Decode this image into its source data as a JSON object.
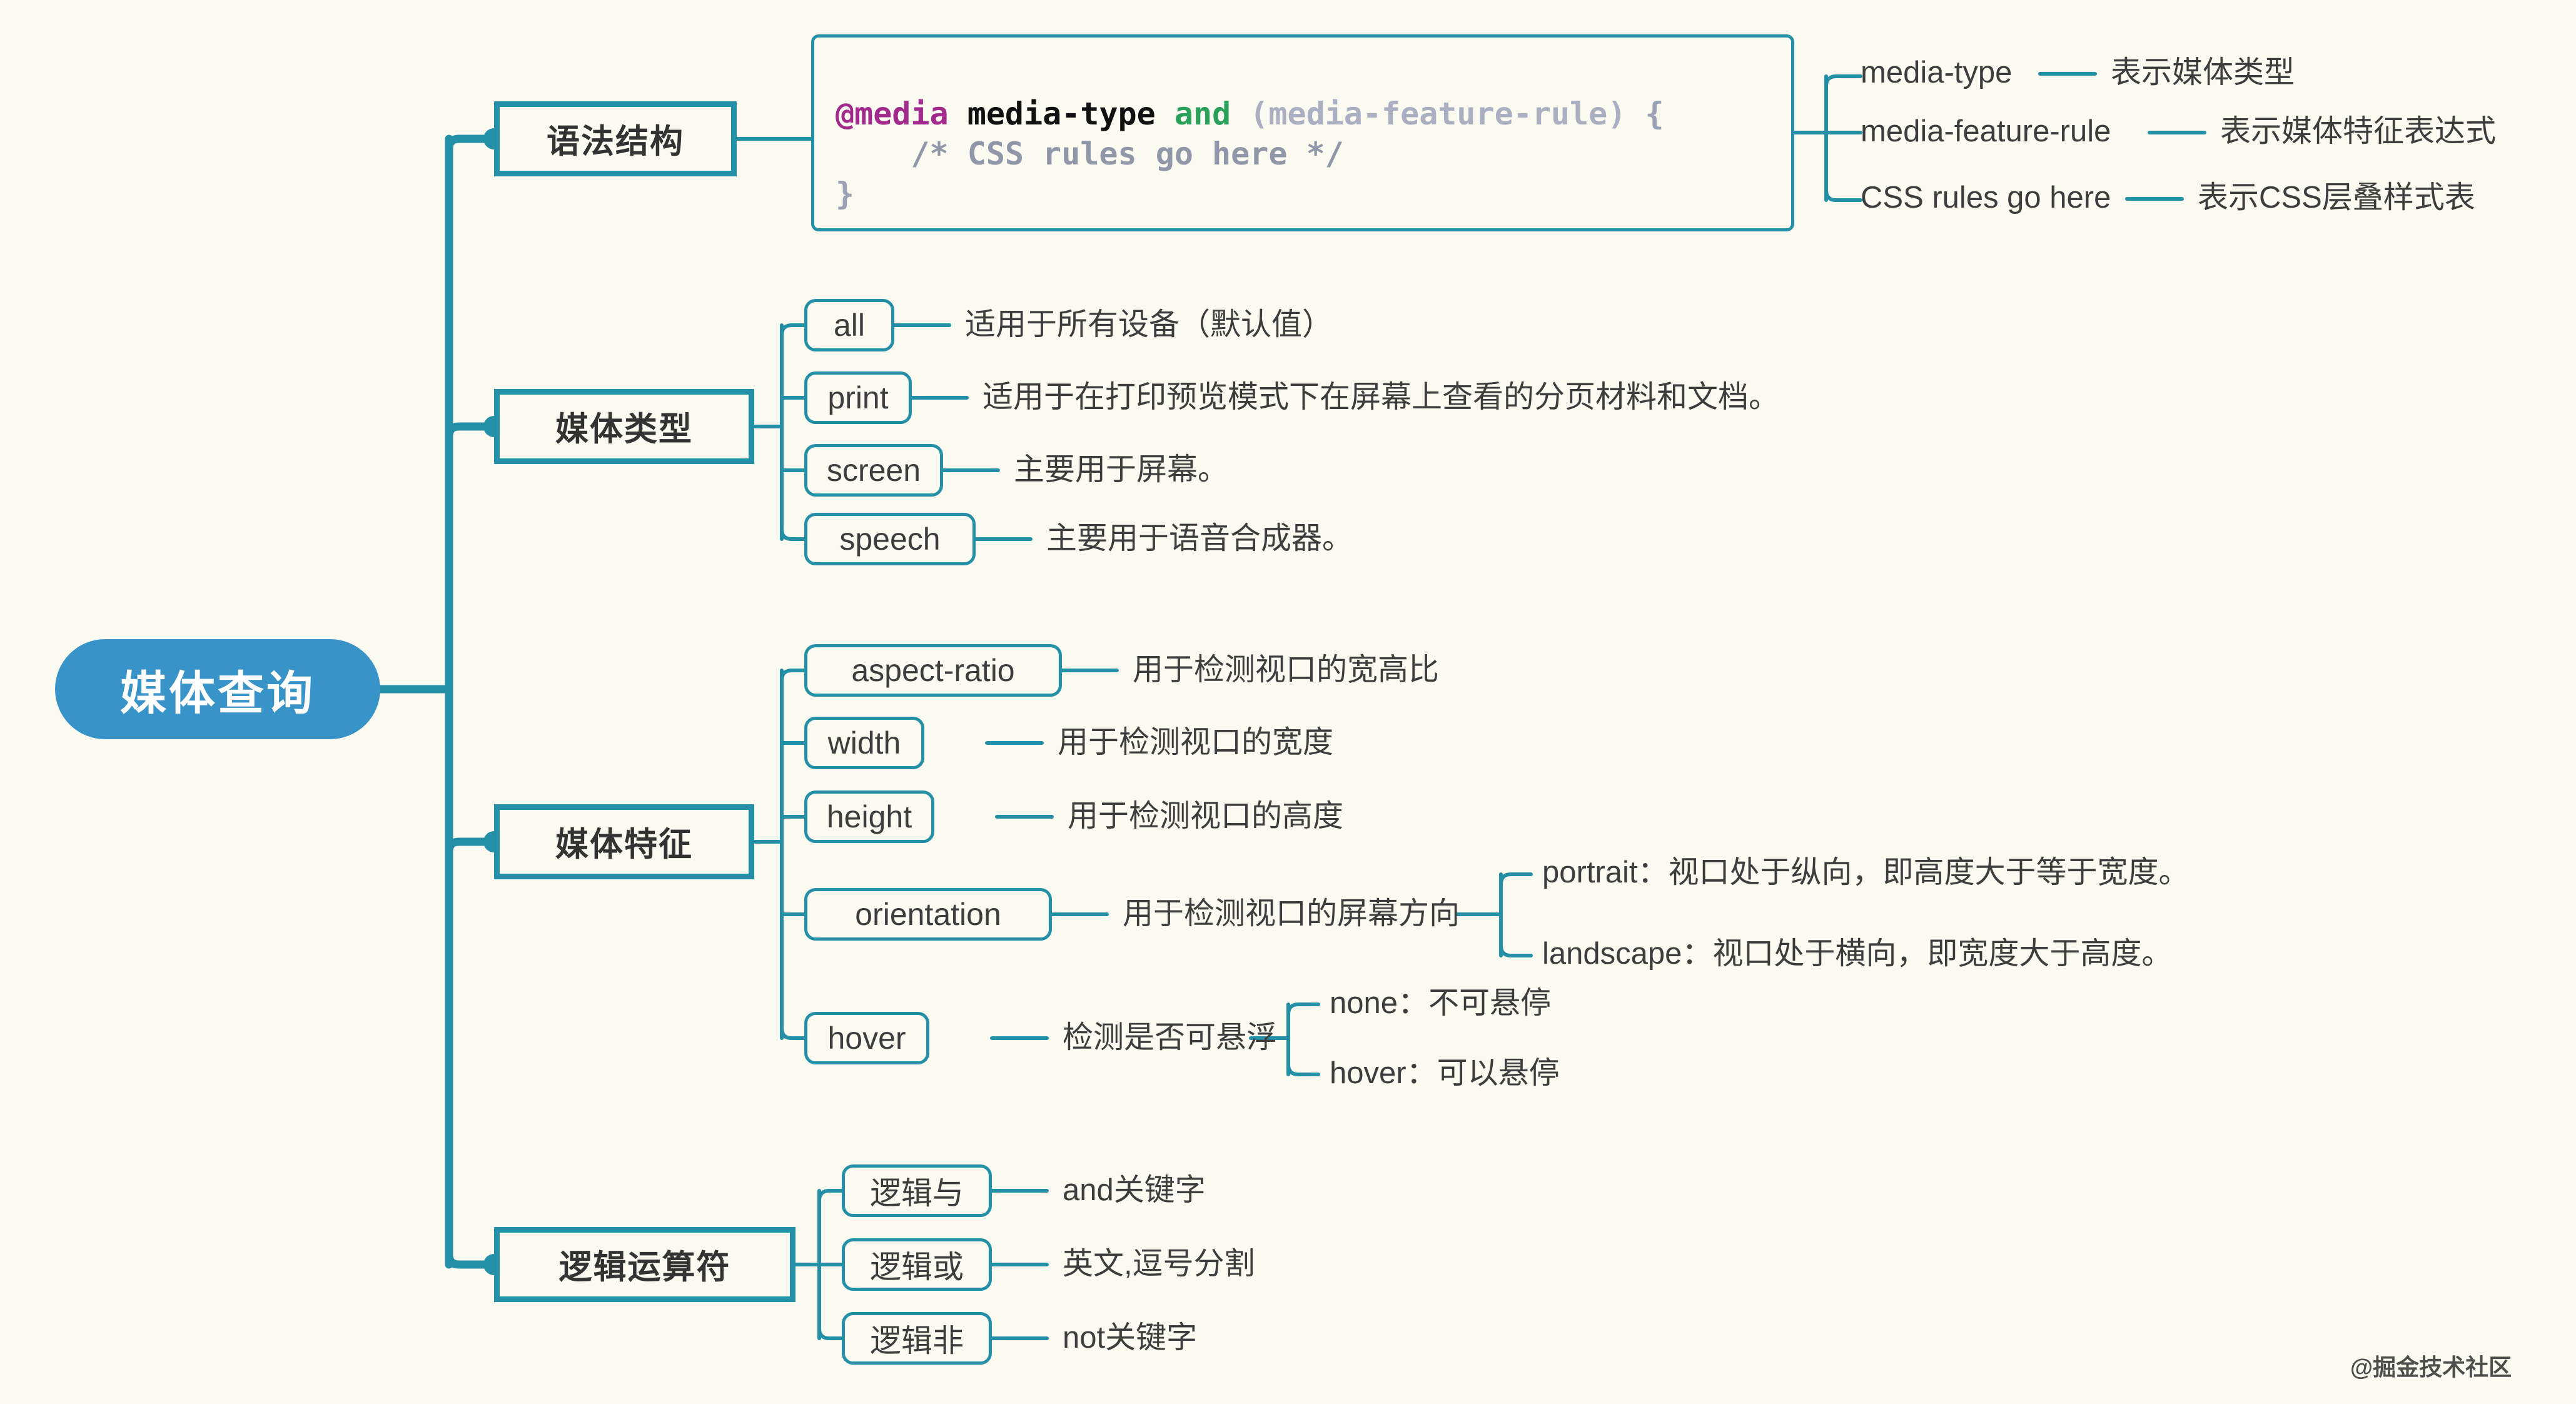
{
  "background_color": "#fbfaf0",
  "accent_color": "#2490a8",
  "root_color": "#3894c8",
  "root": {
    "label": "媒体查询"
  },
  "watermark": {
    "text": "@掘金技术社区"
  },
  "code_block": {
    "line1_at": "@media",
    "line1_type": " media-type ",
    "line1_and": "and",
    "line1_feature": " (media-feature-rule) ",
    "line1_brace": "{",
    "line2_comment": "    /* CSS rules go here */",
    "line3_brace": "}"
  },
  "branches": [
    {
      "id": "syntax",
      "label": "语法结构",
      "children": [
        {
          "term": "media-type",
          "desc": "表示媒体类型"
        },
        {
          "term": "media-feature-rule",
          "desc": "表示媒体特征表达式"
        },
        {
          "term": "CSS rules go here",
          "desc": "表示CSS层叠样式表"
        }
      ]
    },
    {
      "id": "media-types",
      "label": "媒体类型",
      "children": [
        {
          "term": "all",
          "desc": "适用于所有设备（默认值）"
        },
        {
          "term": "print",
          "desc": "适用于在打印预览模式下在屏幕上查看的分页材料和文档。"
        },
        {
          "term": "screen",
          "desc": "主要用于屏幕。"
        },
        {
          "term": "speech",
          "desc": "主要用于语音合成器。"
        }
      ]
    },
    {
      "id": "media-features",
      "label": "媒体特征",
      "children": [
        {
          "term": "aspect-ratio",
          "desc": "用于检测视口的宽高比",
          "sub": []
        },
        {
          "term": "width",
          "desc": "用于检测视口的宽度",
          "sub": []
        },
        {
          "term": "height",
          "desc": "用于检测视口的高度",
          "sub": []
        },
        {
          "term": "orientation",
          "desc": "用于检测视口的屏幕方向",
          "sub": [
            "portrait：视口处于纵向，即高度大于等于宽度。",
            "landscape：视口处于横向，即宽度大于高度。"
          ]
        },
        {
          "term": "hover",
          "desc": "检测是否可悬浮",
          "sub": [
            "none：不可悬停",
            "hover：可以悬停"
          ]
        }
      ]
    },
    {
      "id": "logical-operators",
      "label": "逻辑运算符",
      "children": [
        {
          "term": "逻辑与",
          "desc": "and关键字"
        },
        {
          "term": "逻辑或",
          "desc": "英文,逗号分割"
        },
        {
          "term": "逻辑非",
          "desc": "not关键字"
        }
      ]
    }
  ]
}
